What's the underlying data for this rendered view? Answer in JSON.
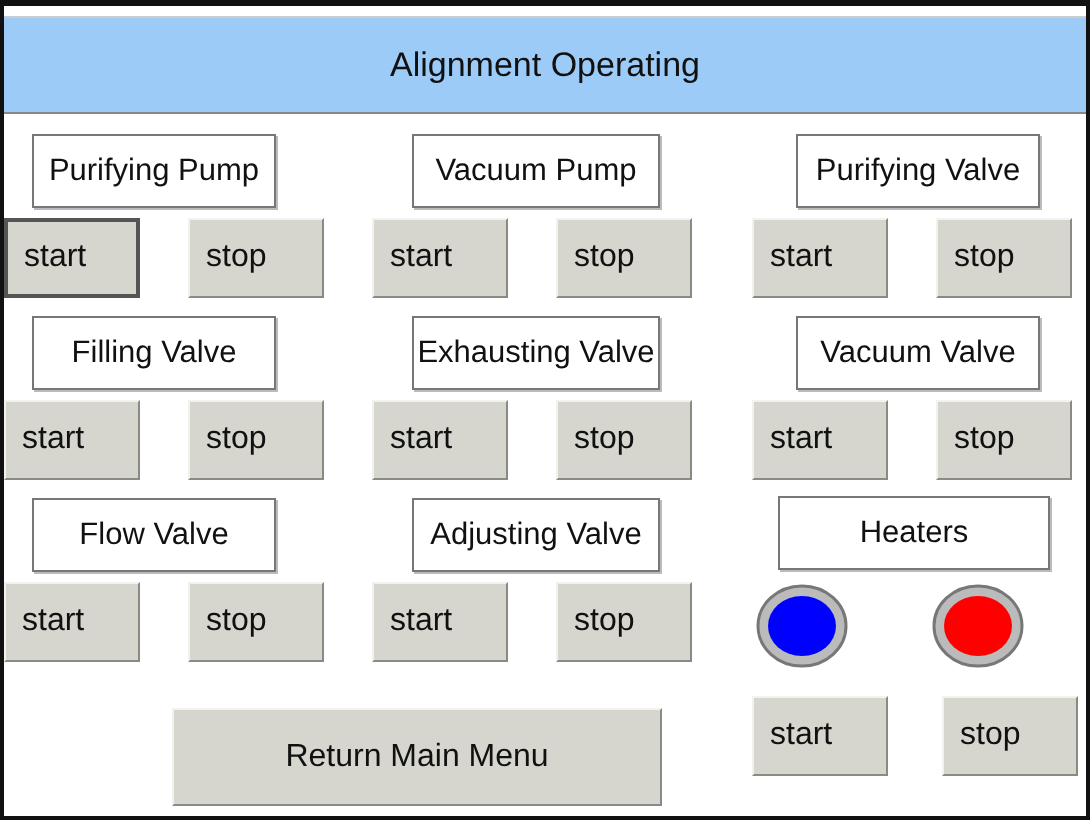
{
  "title": "Alignment Operating",
  "devices": [
    {
      "kind": "device",
      "label": "Purifying Pump",
      "buttons": [
        {
          "label": "start",
          "pressed": true
        },
        {
          "label": "stop",
          "pressed": false
        }
      ]
    },
    {
      "kind": "device",
      "label": "Vacuum Pump",
      "buttons": [
        {
          "label": "start",
          "pressed": false
        },
        {
          "label": "stop",
          "pressed": false
        }
      ]
    },
    {
      "kind": "device",
      "label": "Purifying Valve",
      "buttons": [
        {
          "label": "start",
          "pressed": false
        },
        {
          "label": "stop",
          "pressed": false
        }
      ]
    },
    {
      "kind": "device",
      "label": "Filling Valve",
      "buttons": [
        {
          "label": "start",
          "pressed": false
        },
        {
          "label": "stop",
          "pressed": false
        }
      ]
    },
    {
      "kind": "device",
      "label": "Exhausting Valve",
      "buttons": [
        {
          "label": "start",
          "pressed": false
        },
        {
          "label": "stop",
          "pressed": false
        }
      ]
    },
    {
      "kind": "device",
      "label": "Vacuum Valve",
      "buttons": [
        {
          "label": "start",
          "pressed": false
        },
        {
          "label": "stop",
          "pressed": false
        }
      ]
    },
    {
      "kind": "device",
      "label": "Flow Valve",
      "buttons": [
        {
          "label": "start",
          "pressed": false
        },
        {
          "label": "stop",
          "pressed": false
        }
      ]
    },
    {
      "kind": "device",
      "label": "Adjusting Valve",
      "buttons": [
        {
          "label": "start",
          "pressed": false
        },
        {
          "label": "stop",
          "pressed": false
        }
      ]
    },
    {
      "kind": "heater",
      "label": "Heaters",
      "lamps": [
        {
          "color": "#0000ff"
        },
        {
          "color": "#ff0000"
        }
      ],
      "buttons": [
        {
          "label": "start",
          "pressed": false
        },
        {
          "label": "stop",
          "pressed": false
        }
      ]
    }
  ],
  "return_button": "Return Main Menu"
}
